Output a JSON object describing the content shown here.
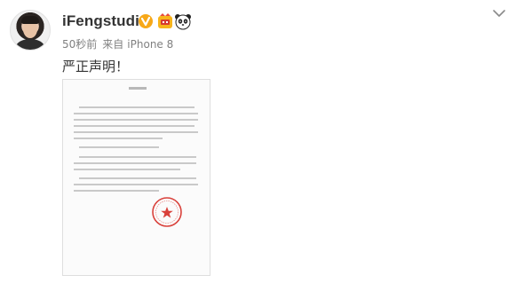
{
  "post": {
    "username": "iFengstudio",
    "time": "50秒前",
    "source_prefix": "来自",
    "source": "iPhone 8",
    "text": "严正声明！"
  },
  "icons": {
    "verified": "verified-badge-icon",
    "badge": "fan-badge-icon",
    "panda": "panda-icon",
    "menu": "chevron-down-icon"
  },
  "colors": {
    "accent_verify": "#f7a818",
    "seal_red": "#d9413b",
    "text_primary": "#333333",
    "text_meta": "#808080"
  }
}
